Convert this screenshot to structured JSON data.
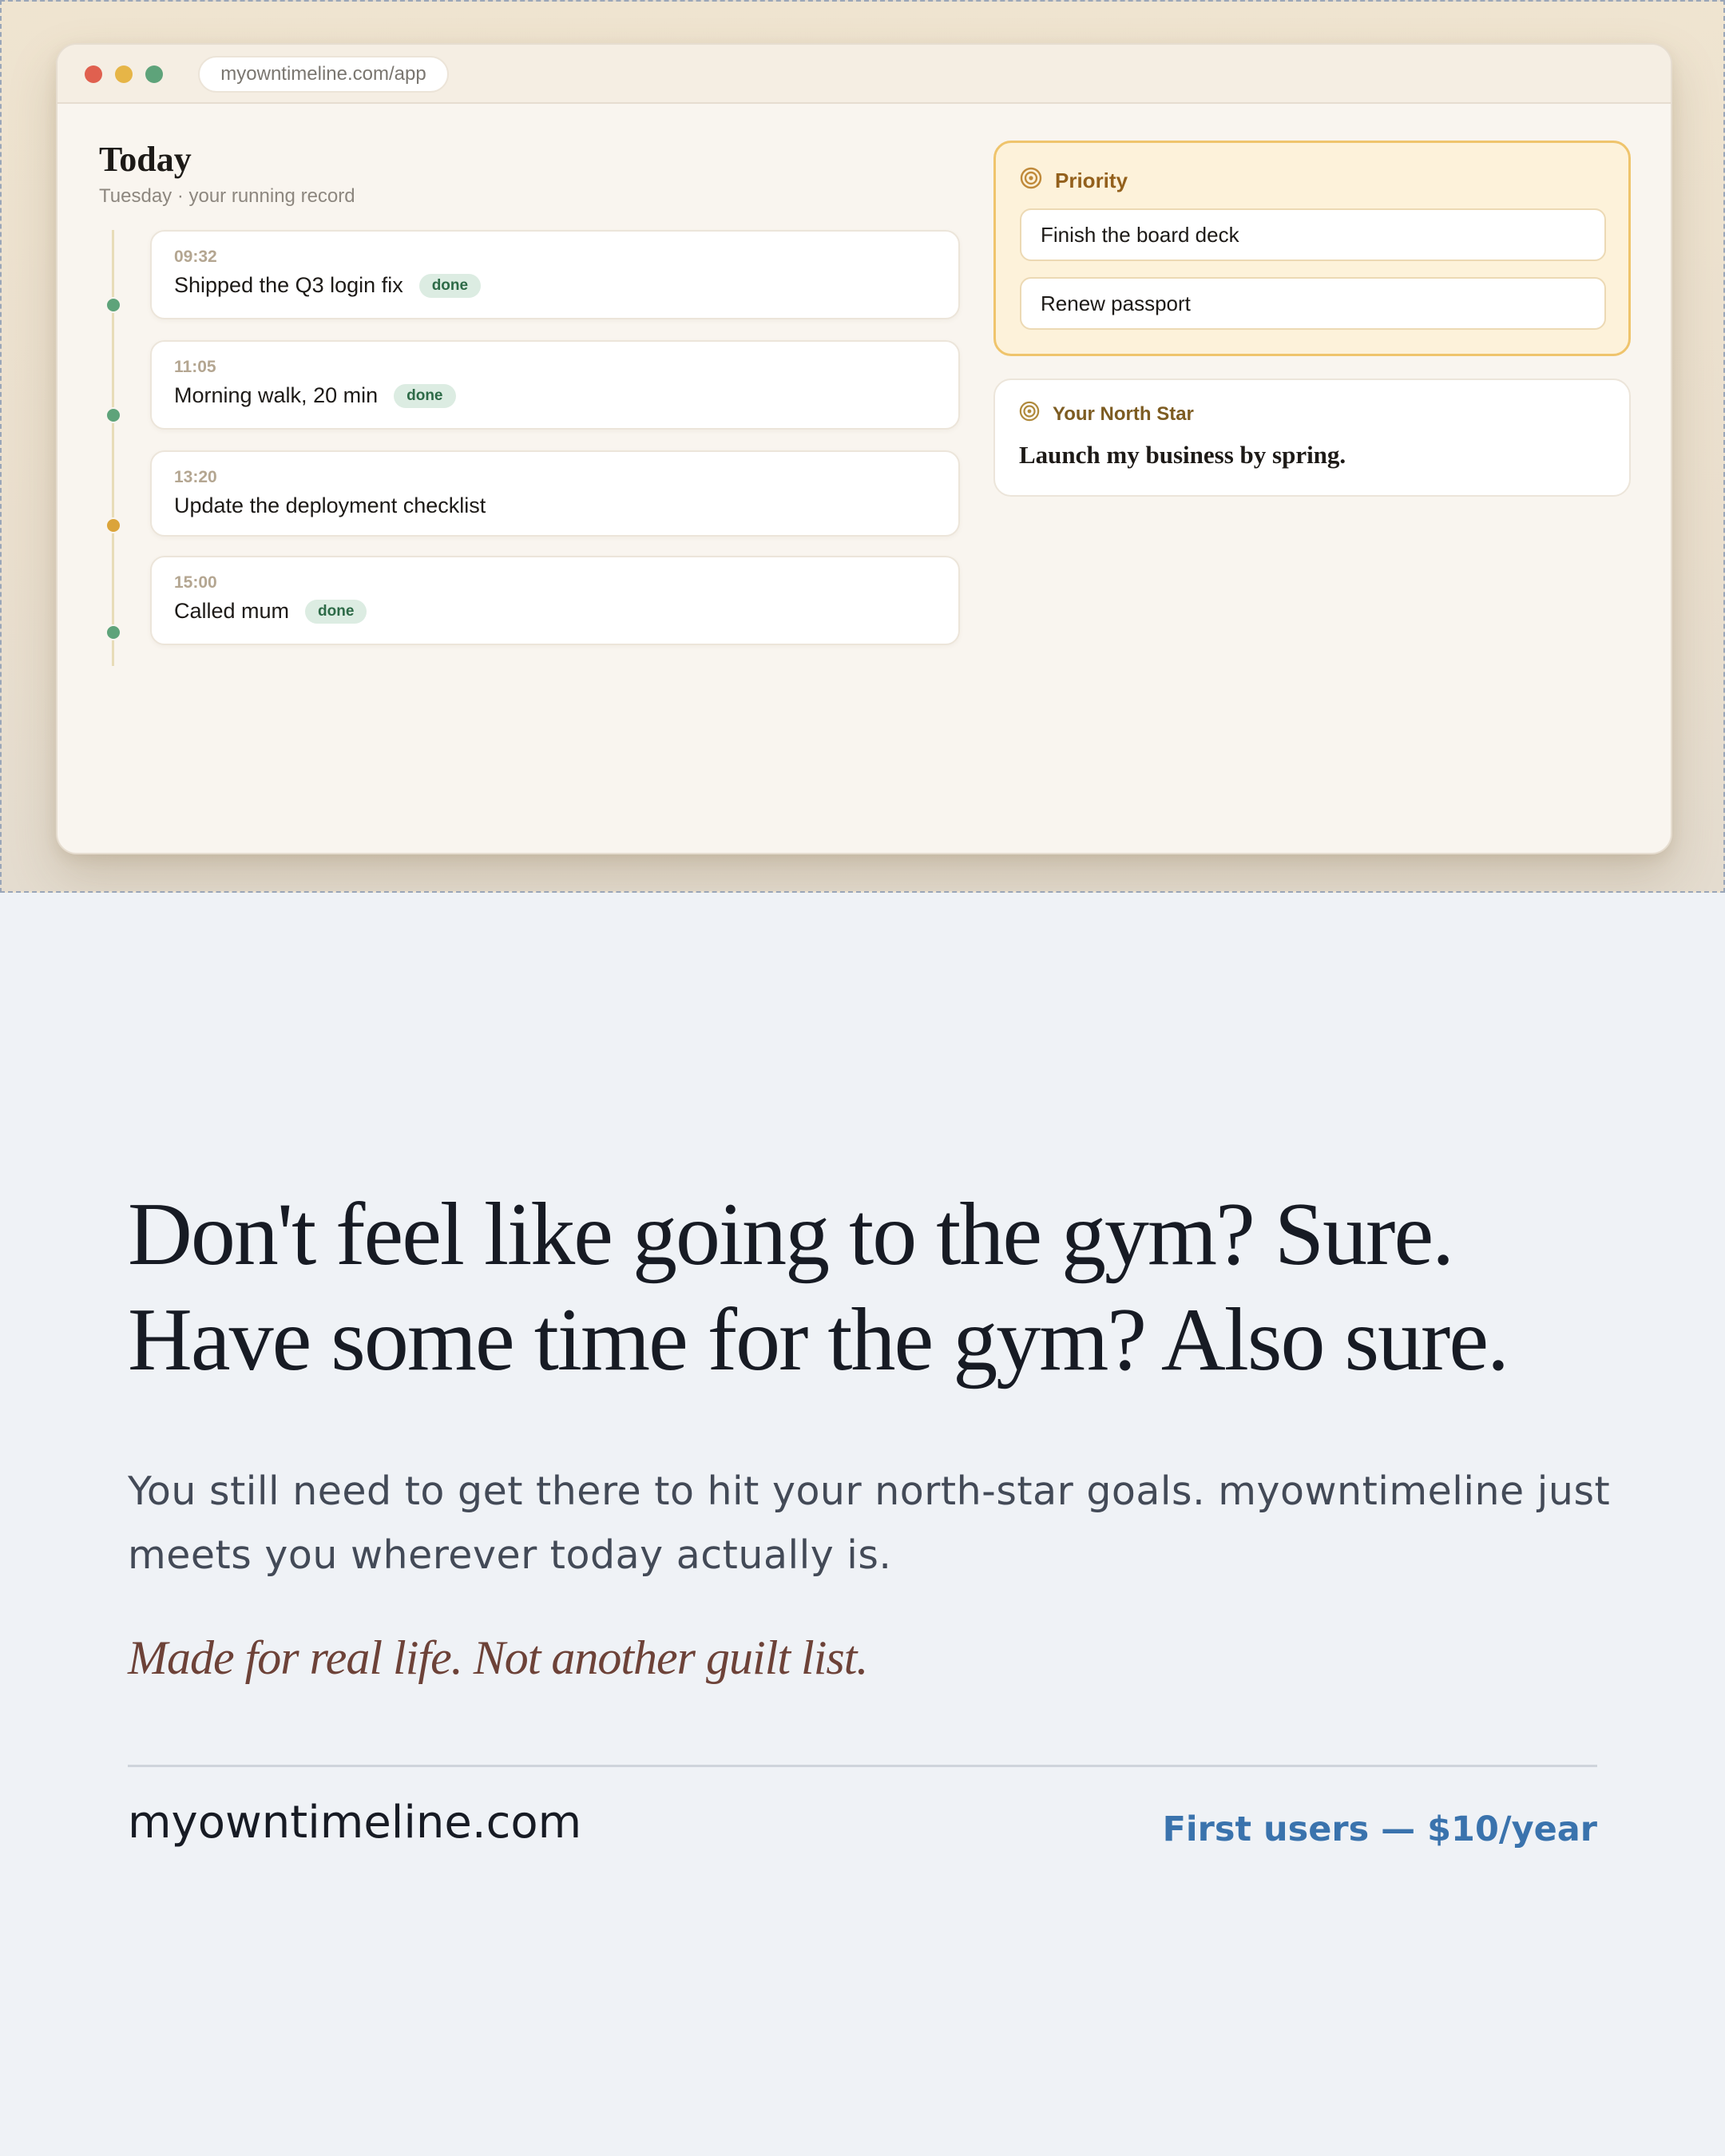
{
  "browser": {
    "url": "myowntimeline.com/app"
  },
  "today": {
    "title": "Today",
    "subtitle": "Tuesday · your running record",
    "entries": [
      {
        "time": "09:32",
        "text": "Shipped the Q3 login fix",
        "badge": "done",
        "status_color": "#5ea37a"
      },
      {
        "time": "11:05",
        "text": "Morning walk, 20 min",
        "badge": "done",
        "status_color": "#5ea37a"
      },
      {
        "time": "13:20",
        "text": "Update the deployment checklist",
        "badge": "",
        "status_color": "#dba43a"
      },
      {
        "time": "15:00",
        "text": "Called mum",
        "badge": "done",
        "status_color": "#5ea37a"
      }
    ]
  },
  "priority": {
    "title": "Priority",
    "icon": "target-icon",
    "items": [
      "Finish the board deck",
      "Renew passport"
    ]
  },
  "north_star": {
    "title": "Your North Star",
    "icon": "target-icon",
    "goal": "Launch my business by spring."
  },
  "copy": {
    "headline_line1": "Don't feel like going to the gym? Sure.",
    "headline_line2": "Have some time for the gym? Also sure.",
    "body": "You still need to get there to hit your north-star goals. myowntimeline just meets you wherever today actually is.",
    "tagline": "Made for real life. Not another guilt list.",
    "domain": "myowntimeline.com",
    "offer": "First users — $10/year"
  },
  "colors": {
    "accent_blue": "#3a73ad",
    "priority_border": "#efc46c",
    "done_green": "#5ea37a",
    "pending_amber": "#dba43a",
    "tagline": "#6d4238"
  }
}
